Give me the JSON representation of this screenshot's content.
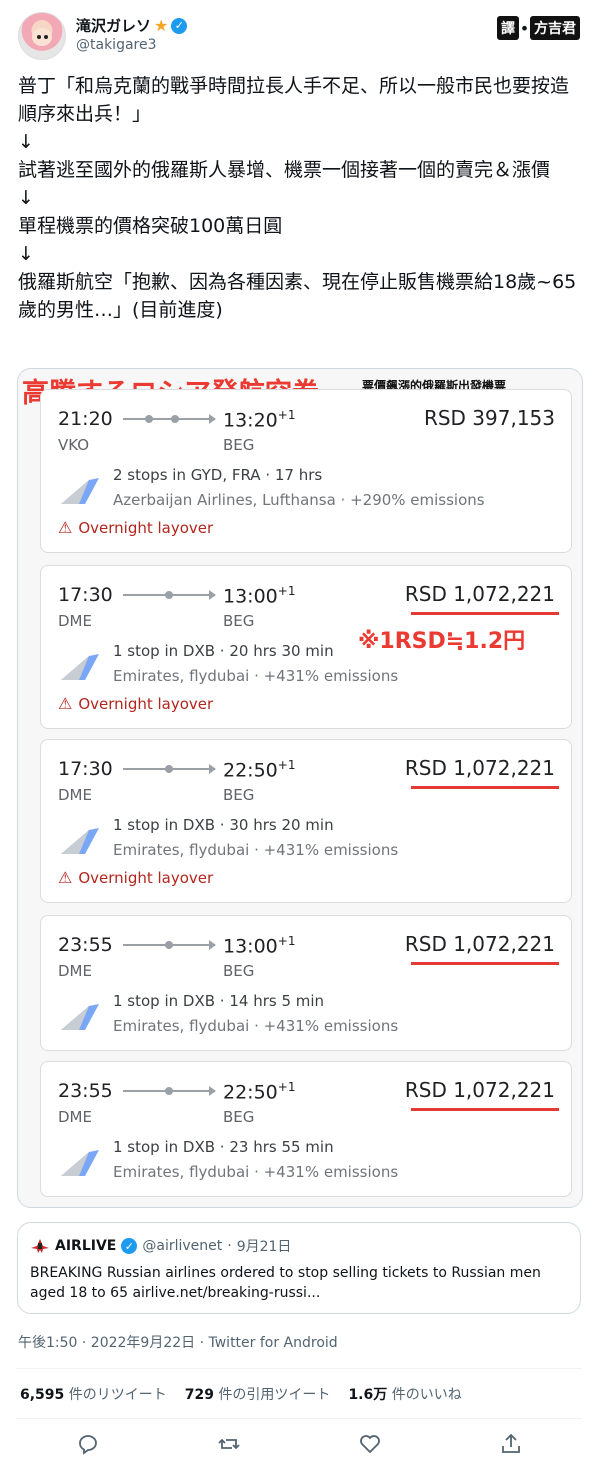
{
  "author": {
    "display_name": "滝沢ガレソ",
    "handle": "@takigare3",
    "star_glyph": "★",
    "verified_glyph": "✓"
  },
  "translator": {
    "pill_left": "譯",
    "dot": "⦁",
    "pill_right": "方吉君"
  },
  "tweet_lines": [
    "普丁「和烏克蘭的戰爭時間拉長人手不足、所以一般市民也要按造順序來出兵！」",
    "↓",
    "試著逃至國外的俄羅斯人暴增、機票一個接著一個的賣完＆漲價",
    "↓",
    "單程機票的價格突破100萬日圓",
    "↓",
    "俄羅斯航空「抱歉、因為各種因素、現在停止販售機票給18歲~65歲的男性…」(目前進度)"
  ],
  "media": {
    "title": "高騰するロシア発航空券",
    "subtitle": "票價飆漲的俄羅斯出發機票",
    "rate_note": "※1RSD≒1.2円",
    "flights": [
      {
        "dep_time": "21:20",
        "arr_time": "13:20",
        "arr_day": "+1",
        "dep_code": "VKO",
        "arr_code": "BEG",
        "price": "RSD 397,153",
        "underlined": false,
        "stops": "2 stops in GYD, FRA · 17 hrs",
        "carriers": "Azerbaijan Airlines, Lufthansa · +290% emissions",
        "warning": "Overnight layover",
        "route_stops": 2
      },
      {
        "dep_time": "17:30",
        "arr_time": "13:00",
        "arr_day": "+1",
        "dep_code": "DME",
        "arr_code": "BEG",
        "price": "RSD 1,072,221",
        "underlined": true,
        "stops": "1 stop in DXB · 20 hrs 30 min",
        "carriers": "Emirates, flydubai · +431% emissions",
        "warning": "Overnight layover",
        "route_stops": 1
      },
      {
        "dep_time": "17:30",
        "arr_time": "22:50",
        "arr_day": "+1",
        "dep_code": "DME",
        "arr_code": "BEG",
        "price": "RSD 1,072,221",
        "underlined": true,
        "stops": "1 stop in DXB · 30 hrs 20 min",
        "carriers": "Emirates, flydubai · +431% emissions",
        "warning": "Overnight layover",
        "route_stops": 1
      },
      {
        "dep_time": "23:55",
        "arr_time": "13:00",
        "arr_day": "+1",
        "dep_code": "DME",
        "arr_code": "BEG",
        "price": "RSD 1,072,221",
        "underlined": true,
        "stops": "1 stop in DXB · 14 hrs 5 min",
        "carriers": "Emirates, flydubai · +431% emissions",
        "warning": "",
        "route_stops": 1
      },
      {
        "dep_time": "23:55",
        "arr_time": "22:50",
        "arr_day": "+1",
        "dep_code": "DME",
        "arr_code": "BEG",
        "price": "RSD 1,072,221",
        "underlined": true,
        "stops": "1 stop in DXB · 23 hrs 55 min",
        "carriers": "Emirates, flydubai · +431% emissions",
        "warning": "",
        "route_stops": 1
      }
    ]
  },
  "quote": {
    "name": "AIRLIVE",
    "handle": "@airlivenet",
    "sep": "·",
    "date": "9月21日",
    "text": "BREAKING Russian airlines ordered to stop selling tickets to Russian men aged 18 to 65 airlive.net/breaking-russi..."
  },
  "meta": {
    "timestamp": "午後1:50 · 2022年9月22日 · Twitter for Android"
  },
  "stats": {
    "retweets_count": "6,595",
    "retweets_label": "件のリツイート",
    "quotes_count": "729",
    "quotes_label": "件の引用ツイート",
    "likes_count": "1.6万",
    "likes_label": "件のいいね"
  },
  "colors": {
    "accent_red": "#ea3a32",
    "twitter_blue": "#1d9bf0",
    "warning_red": "#b3261e"
  },
  "icons": [
    "reply-icon",
    "retweet-icon",
    "like-icon",
    "share-icon"
  ]
}
